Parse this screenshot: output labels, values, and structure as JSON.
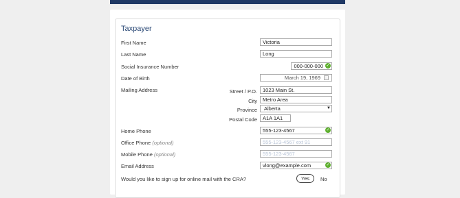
{
  "section_title": "Taxpayer",
  "fields": {
    "first_name": {
      "label": "First Name",
      "value": "Victoria"
    },
    "last_name": {
      "label": "Last Name",
      "value": "Long"
    },
    "sin": {
      "label": "Social Insurance Number",
      "value": "000-000-000"
    },
    "dob": {
      "label": "Date of Birth",
      "value": "March 19, 1969"
    },
    "mailing": {
      "label": "Mailing Address",
      "street_label": "Street / P.O.",
      "street_value": "1023 Main St.",
      "city_label": "City",
      "city_value": "Metro Area",
      "province_label": "Province",
      "province_value": "Alberta",
      "postal_label": "Postal Code",
      "postal_value": "A1A 1A1"
    },
    "home_phone": {
      "label": "Home Phone",
      "value": "555-123-4567"
    },
    "office_phone": {
      "label": "Office Phone",
      "optional": "(optional)",
      "placeholder": "555-123-4567 ext 91"
    },
    "mobile_phone": {
      "label": "Mobile Phone",
      "optional": "(optional)",
      "placeholder": "555-123-4567"
    },
    "email": {
      "label": "Email Address",
      "value": "vlong@example.com"
    }
  },
  "online_mail": {
    "question": "Would you like to sign up for online mail with the CRA?",
    "yes_label": "Yes",
    "no_label": "No"
  },
  "icons": {
    "valid": "check-circle-icon",
    "calendar": "calendar-icon",
    "dropdown": "chevron-down-icon"
  },
  "colors": {
    "header": "#1f3864",
    "title": "#2c4a77",
    "valid": "#5fb030"
  }
}
